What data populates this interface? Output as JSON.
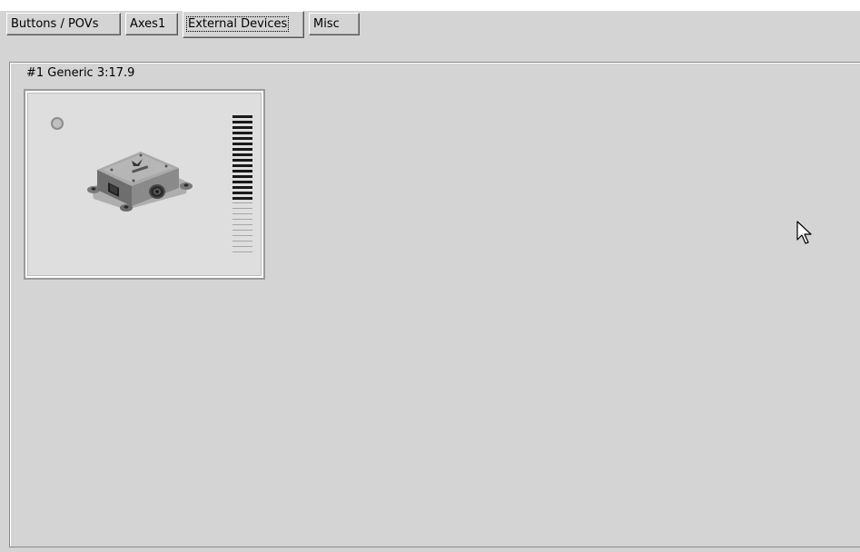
{
  "tabs": [
    {
      "label": "Buttons / POVs",
      "selected": false
    },
    {
      "label": "Axes1",
      "selected": false
    },
    {
      "label": "External Devices",
      "selected": true
    },
    {
      "label": "Misc",
      "selected": false
    }
  ],
  "device": {
    "title": "#1 Generic 3:17.9",
    "status_icon": "led-indicator-icon",
    "image_icon": "sensor-device-icon",
    "level": {
      "total_segments": 26,
      "active_segments": 16,
      "active_color": "#1a1a1a",
      "inactive_color": "#a6a6a6"
    }
  },
  "colors": {
    "window_bg": "#d4d4d4",
    "card_bg": "#dedede"
  }
}
